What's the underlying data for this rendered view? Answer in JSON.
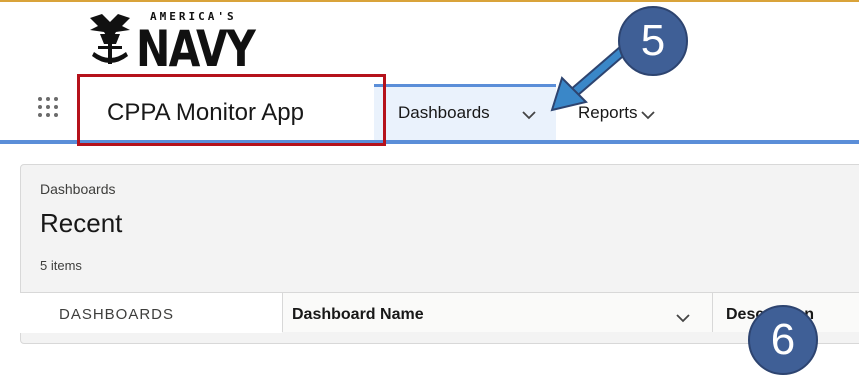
{
  "logo": {
    "top_text": "AMERICA'S",
    "main_text": "NAVY"
  },
  "nav": {
    "app_name": "CPPA Monitor App",
    "tabs": [
      {
        "label": "Dashboards",
        "active": true
      },
      {
        "label": "Reports",
        "active": false
      }
    ]
  },
  "annotations": {
    "callout_5": "5",
    "callout_6": "6"
  },
  "page": {
    "breadcrumb": "Dashboards",
    "title": "Recent",
    "item_count": "5 items"
  },
  "sidebar": {
    "header": "DASHBOARDS"
  },
  "table": {
    "columns": [
      "Dashboard Name",
      "Description"
    ]
  },
  "colors": {
    "nav_accent": "#5b8ed8",
    "highlight_box": "#b5121b",
    "callout_fill": "#3f5f96",
    "arrow": "#3a87c8",
    "top_rule": "#d9a33a"
  }
}
